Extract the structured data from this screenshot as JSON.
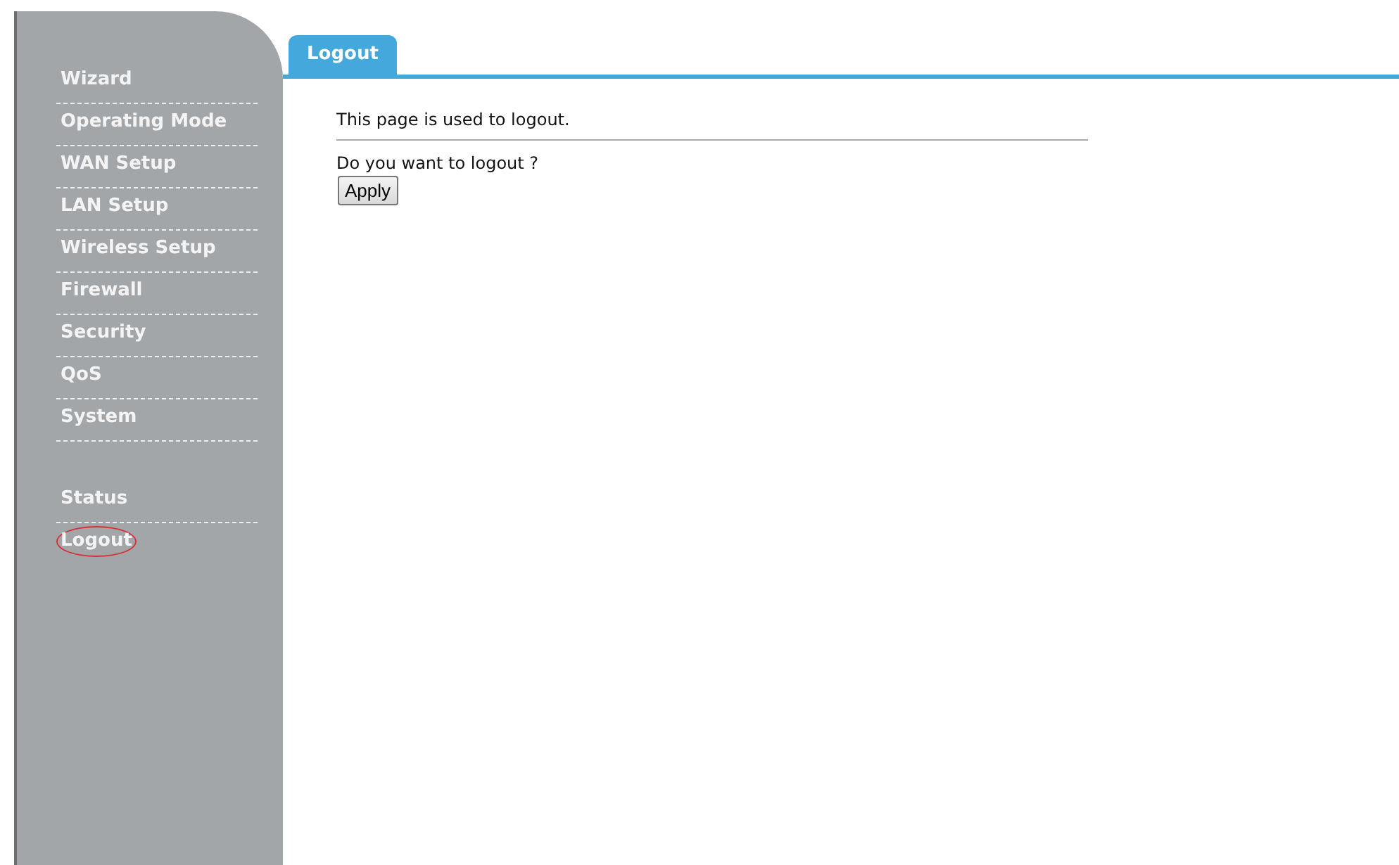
{
  "sidebar": {
    "groups": [
      {
        "items": [
          {
            "label": "Wizard",
            "circled": false
          },
          {
            "label": "Operating Mode",
            "circled": false
          },
          {
            "label": "WAN Setup",
            "circled": false
          },
          {
            "label": "LAN Setup",
            "circled": false
          },
          {
            "label": "Wireless Setup",
            "circled": false
          },
          {
            "label": "Firewall",
            "circled": false
          },
          {
            "label": "Security",
            "circled": false
          },
          {
            "label": "QoS",
            "circled": false
          },
          {
            "label": "System",
            "circled": false
          }
        ]
      },
      {
        "items": [
          {
            "label": "Status",
            "circled": false
          },
          {
            "label": "Logout",
            "circled": true
          }
        ]
      }
    ]
  },
  "tabs": [
    {
      "label": "Logout",
      "selected": true
    }
  ],
  "content": {
    "description": "This page is used to logout.",
    "question": "Do you want to logout ?",
    "button": "Apply"
  }
}
